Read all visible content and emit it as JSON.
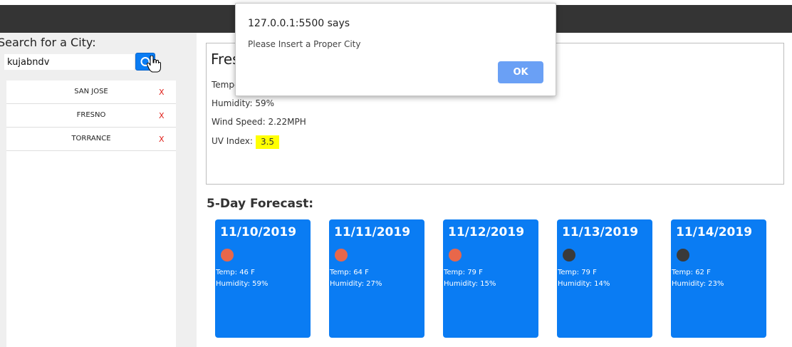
{
  "search": {
    "label": "Search for a City:",
    "value": "kujabndv"
  },
  "cities": [
    {
      "name": "SAN JOSE",
      "delete": "X"
    },
    {
      "name": "FRESNO",
      "delete": "X"
    },
    {
      "name": "TORRANCE",
      "delete": "X"
    }
  ],
  "current": {
    "city": "Fres",
    "temperature_label": "Tempe",
    "humidity": "Humidity: 59%",
    "wind": "Wind Speed: 2.22MPH",
    "uv_label": "UV Index:",
    "uv_value": "3.5"
  },
  "forecast": {
    "title": "5-Day Forecast:",
    "days": [
      {
        "date": "11/10/2019",
        "icon": "sun-icon",
        "icon_color": "#e8674a",
        "temp": "Temp: 46 F",
        "humidity": "Humidity: 59%"
      },
      {
        "date": "11/11/2019",
        "icon": "sun-icon",
        "icon_color": "#e8674a",
        "temp": "Temp: 64 F",
        "humidity": "Humidity: 27%"
      },
      {
        "date": "11/12/2019",
        "icon": "sun-icon",
        "icon_color": "#e8674a",
        "temp": "Temp: 79 F",
        "humidity": "Humidity: 15%"
      },
      {
        "date": "11/13/2019",
        "icon": "cloud-icon",
        "icon_color": "#3a3a3a",
        "temp": "Temp: 79 F",
        "humidity": "Humidity: 14%"
      },
      {
        "date": "11/14/2019",
        "icon": "cloud-icon",
        "icon_color": "#3a3a3a",
        "temp": "Temp: 62 F",
        "humidity": "Humidity: 23%"
      }
    ]
  },
  "dialog": {
    "origin": "127.0.0.1:5500 says",
    "message": "Please Insert a Proper City",
    "ok_label": "OK"
  },
  "colors": {
    "accent": "#0a7cf3",
    "topbar": "#343434",
    "uv_highlight": "#ffff00",
    "delete": "#e0201a"
  }
}
